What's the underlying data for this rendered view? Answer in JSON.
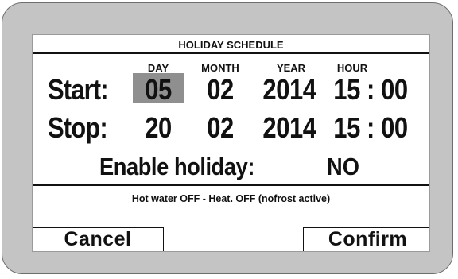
{
  "screen": {
    "title": "HOLIDAY SCHEDULE",
    "columns": {
      "day": "DAY",
      "month": "MONTH",
      "year": "YEAR",
      "hour": "HOUR"
    },
    "start": {
      "label": "Start:",
      "day": "05",
      "month": "02",
      "year": "2014",
      "hour": "15 : 00"
    },
    "stop": {
      "label": "Stop:",
      "day": "20",
      "month": "02",
      "year": "2014",
      "hour": "15 : 00"
    },
    "enable": {
      "label": "Enable holiday:",
      "value": "NO"
    },
    "status": "Hot water OFF - Heat. OFF (nofrost active)",
    "buttons": {
      "cancel": "Cancel",
      "confirm": "Confirm"
    },
    "selected_field": "start.day",
    "colors": {
      "bezel": "#c4c4c4",
      "selection": "#8f8f8f",
      "text": "#111111"
    }
  }
}
